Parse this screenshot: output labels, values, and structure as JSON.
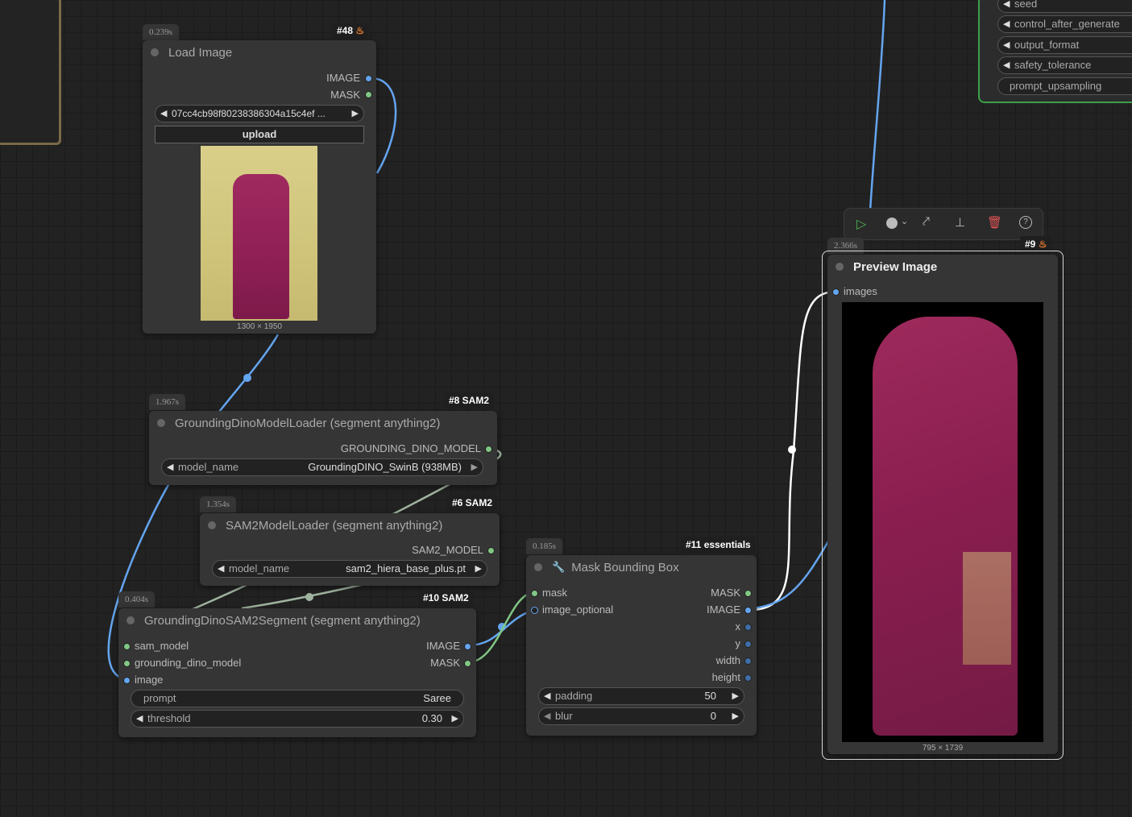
{
  "colors": {
    "image": "#64a5f0",
    "mask": "#81c784",
    "model": "#a0b4a0",
    "white": "#ffffff"
  },
  "nodes": {
    "load_image": {
      "time": "0.239s",
      "id": "#48",
      "title": "Load Image",
      "outputs": [
        "IMAGE",
        "MASK"
      ],
      "file": "07cc4cb98f80238386304a15c4ef ...",
      "upload_label": "upload",
      "dims": "1300 × 1950"
    },
    "dino_loader": {
      "time": "1.967s",
      "id": "#8 SAM2",
      "title": "GroundingDinoModelLoader (segment anything2)",
      "output": "GROUNDING_DINO_MODEL",
      "widget_label": "model_name",
      "widget_value": "GroundingDINO_SwinB (938MB)"
    },
    "sam_loader": {
      "time": "1.354s",
      "id": "#6 SAM2",
      "title": "SAM2ModelLoader (segment anything2)",
      "output": "SAM2_MODEL",
      "widget_label": "model_name",
      "widget_value": "sam2_hiera_base_plus.pt"
    },
    "segment": {
      "time": "0.404s",
      "id": "#10 SAM2",
      "title": "GroundingDinoSAM2Segment (segment anything2)",
      "inputs": [
        "sam_model",
        "grounding_dino_model",
        "image"
      ],
      "outputs": [
        "IMAGE",
        "MASK"
      ],
      "prompt_label": "prompt",
      "prompt_value": "Saree",
      "threshold_label": "threshold",
      "threshold_value": "0.30"
    },
    "mask_bbox": {
      "time": "0.185s",
      "id": "#11 essentials",
      "title": "Mask Bounding Box",
      "inputs": [
        "mask",
        "image_optional"
      ],
      "outputs": [
        "MASK",
        "IMAGE",
        "x",
        "y",
        "width",
        "height"
      ],
      "padding_label": "padding",
      "padding_value": "50",
      "blur_label": "blur",
      "blur_value": "0"
    },
    "preview": {
      "time": "2.366s",
      "id": "#9",
      "title": "Preview Image",
      "input": "images",
      "dims": "795 × 1739"
    }
  },
  "side_panel": {
    "items": [
      "seed",
      "control_after_generate",
      "output_format",
      "safety_tolerance",
      "prompt_upsampling"
    ]
  },
  "toolbar": {
    "icons": [
      "play-icon",
      "color-icon",
      "bypass-icon",
      "pin-icon",
      "delete-icon",
      "help-icon"
    ]
  }
}
